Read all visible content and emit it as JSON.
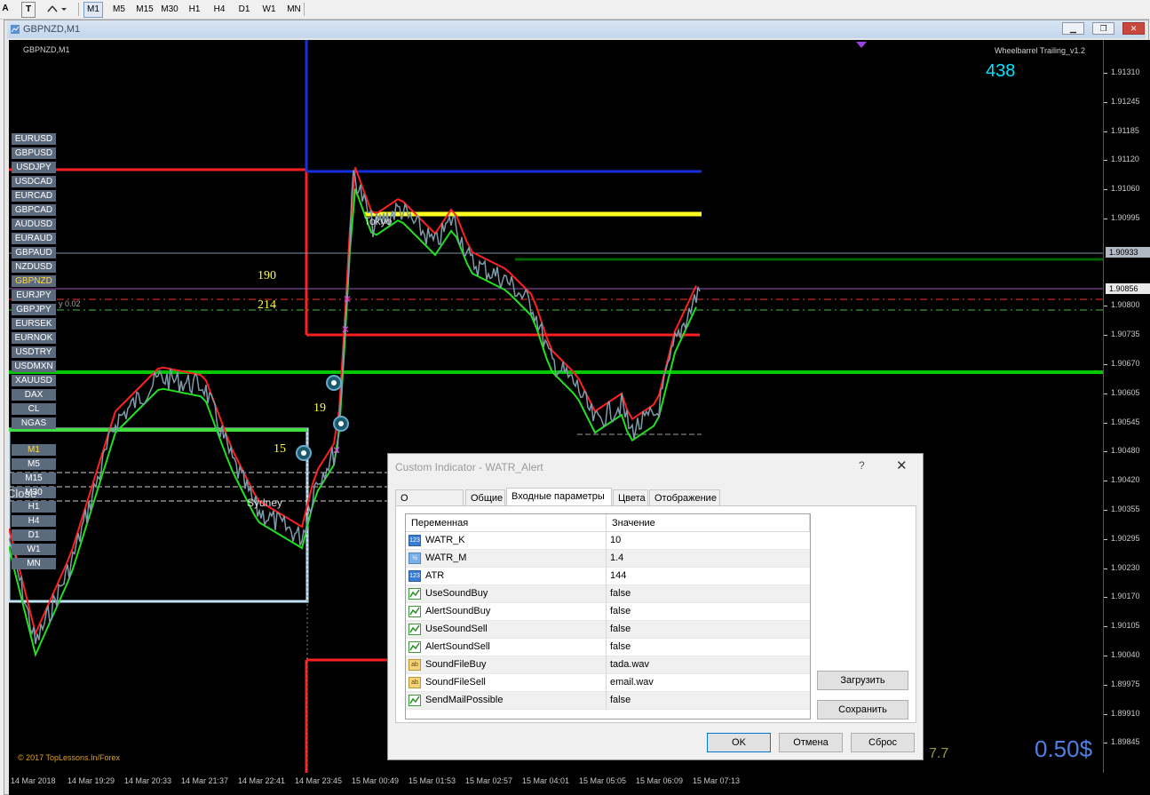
{
  "toolbar": {
    "left_icons": [
      "A",
      "T",
      "objects"
    ],
    "timeframes": [
      "M1",
      "M5",
      "M15",
      "M30",
      "H1",
      "H4",
      "D1",
      "W1",
      "MN"
    ],
    "active_timeframe": "M1"
  },
  "window": {
    "title": "GBPNZD,M1",
    "controls": [
      "minimize",
      "restore",
      "close"
    ]
  },
  "chart": {
    "symbol_label": "GBPNZD,M1",
    "indicator_name": "Wheelbarrel Trailing_v1.2",
    "counter": "438",
    "counter_color": "#00e5ff",
    "symbols": [
      "EURUSD",
      "GBPUSD",
      "USDJPY",
      "USDCAD",
      "EURCAD",
      "GBPCAD",
      "AUDUSD",
      "EURAUD",
      "GBPAUD",
      "NZDUSD",
      "GBPNZD",
      "EURJPY",
      "GBPJPY",
      "EURSEK",
      "EURNOK",
      "USDTRY",
      "USDMXN",
      "XAUUSD",
      "DAX",
      "CL",
      "NGAS"
    ],
    "selected_symbol": "GBPNZD",
    "tf_buttons": [
      "M1",
      "M5",
      "M15",
      "M30",
      "H1",
      "H4",
      "D1",
      "W1",
      "MN"
    ],
    "selected_tf": "M1",
    "labels": {
      "n190": "190",
      "n214": "214",
      "n19": "19",
      "n15": "15",
      "close_label": "Close",
      "tokyo": "Tokyo",
      "sydney": "Sydney",
      "lot": "y 0.02",
      "value_7_7": "7.7",
      "profit": "0.50$",
      "copyright": "© 2017 TopLessons.In/Forex"
    },
    "price_ticks": [
      "1.91310",
      "1.91245",
      "1.91185",
      "1.91120",
      "1.91060",
      "1.90995",
      "1.90933",
      "1.90856",
      "1.90800",
      "1.90735",
      "1.90670",
      "1.90605",
      "1.90545",
      "1.90480",
      "1.90420",
      "1.90355",
      "1.90295",
      "1.90230",
      "1.90170",
      "1.90105",
      "1.90040",
      "1.89975",
      "1.89910",
      "1.89845"
    ],
    "price_box_1": "1.90933",
    "price_box_2": "1.90856",
    "time_ticks": [
      "14 Mar 2018",
      "14 Mar 19:29",
      "14 Mar 20:33",
      "14 Mar 21:37",
      "14 Mar 22:41",
      "14 Mar 23:45",
      "15 Mar 00:49",
      "15 Mar 01:53",
      "15 Mar 02:57",
      "15 Mar 04:01",
      "15 Mar 05:05",
      "15 Mar 06:09",
      "15 Mar 07:13"
    ]
  },
  "dialog": {
    "title": "Custom Indicator - WATR_Alert",
    "help": "?",
    "tabs": [
      "О программе",
      "Общие",
      "Входные параметры",
      "Цвета",
      "Отображение"
    ],
    "active_tab": "Входные параметры",
    "columns": {
      "name": "Переменная",
      "value": "Значение"
    },
    "params": [
      {
        "name": "WATR_K",
        "value": "10",
        "icon": "int"
      },
      {
        "name": "WATR_M",
        "value": "1.4",
        "icon": "double"
      },
      {
        "name": "ATR",
        "value": "144",
        "icon": "int"
      },
      {
        "name": "UseSoundBuy",
        "value": "false",
        "icon": "bool"
      },
      {
        "name": "AlertSoundBuy",
        "value": "false",
        "icon": "bool"
      },
      {
        "name": "UseSoundSell",
        "value": "false",
        "icon": "bool"
      },
      {
        "name": "AlertSoundSell",
        "value": "false",
        "icon": "bool"
      },
      {
        "name": "SoundFileBuy",
        "value": "tada.wav",
        "icon": "string"
      },
      {
        "name": "SoundFileSell",
        "value": "email.wav",
        "icon": "string"
      },
      {
        "name": "SendMailPossible",
        "value": "false",
        "icon": "bool"
      }
    ],
    "load_button": "Загрузить",
    "save_button": "Сохранить",
    "ok_button": "OK",
    "cancel_button": "Отмена",
    "reset_button": "Сброс"
  }
}
